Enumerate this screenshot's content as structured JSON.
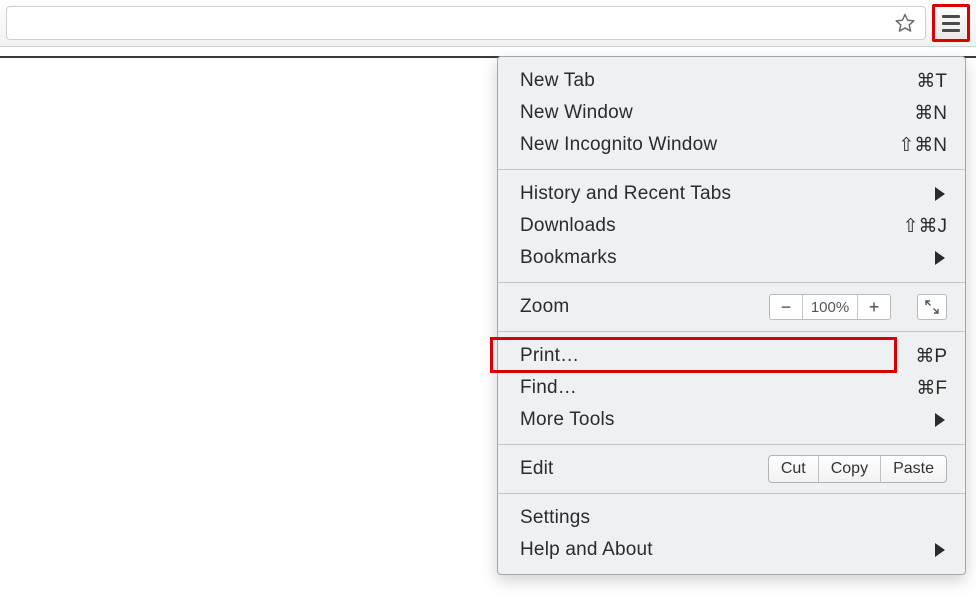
{
  "menu": {
    "new_tab": {
      "label": "New Tab",
      "shortcut": "⌘T"
    },
    "new_window": {
      "label": "New Window",
      "shortcut": "⌘N"
    },
    "incognito": {
      "label": "New Incognito Window",
      "shortcut": "⇧⌘N"
    },
    "history": {
      "label": "History and Recent Tabs"
    },
    "downloads": {
      "label": "Downloads",
      "shortcut": "⇧⌘J"
    },
    "bookmarks": {
      "label": "Bookmarks"
    },
    "zoom": {
      "label": "Zoom",
      "pct": "100%",
      "minus": "−",
      "plus": "+"
    },
    "print": {
      "label": "Print…",
      "shortcut": "⌘P"
    },
    "find": {
      "label": "Find…",
      "shortcut": "⌘F"
    },
    "more_tools": {
      "label": "More Tools"
    },
    "edit": {
      "label": "Edit",
      "cut": "Cut",
      "copy": "Copy",
      "paste": "Paste"
    },
    "settings": {
      "label": "Settings"
    },
    "help": {
      "label": "Help and About"
    }
  }
}
